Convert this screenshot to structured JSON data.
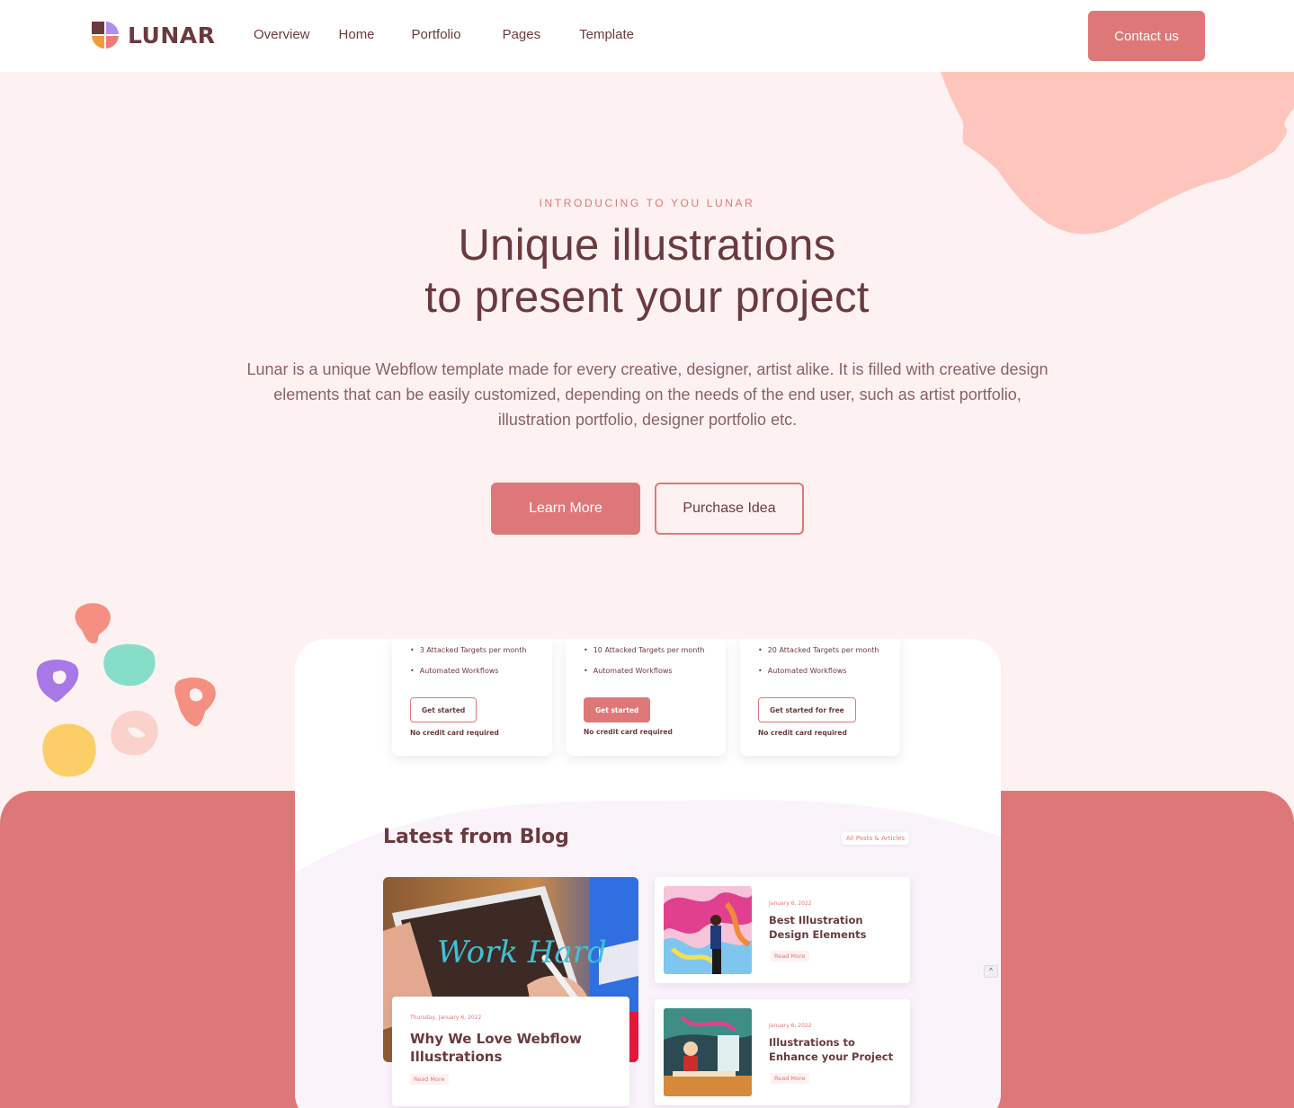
{
  "brand": {
    "name": "LUNAR"
  },
  "nav": {
    "links": [
      "Overview",
      "Home",
      "Portfolio",
      "Pages",
      "Template"
    ],
    "contact_label": "Contact us"
  },
  "hero": {
    "eyebrow": "INTRODUCING TO YOU LUNAR",
    "title_line1": "Unique illustrations",
    "title_line2": "to present your project",
    "lead": "Lunar is a unique Webflow template made for every creative, designer, artist alike. It is filled with creative design elements that can be easily customized, depending on the needs of the end user, such as artist portfolio, illustration portfolio, designer portfolio etc.",
    "learn_more": "Learn More",
    "purchase": "Purchase Idea"
  },
  "pricing_preview": [
    {
      "features": [
        "3 Attacked Targets per month",
        "Automated Workflows"
      ],
      "button": "Get started",
      "note": "No credit card required",
      "highlighted": false
    },
    {
      "features": [
        "10 Attacked Targets per month",
        "Automated Workflows"
      ],
      "button": "Get started",
      "note": "No credit card required",
      "highlighted": true
    },
    {
      "features": [
        "20 Attacked Targets per month",
        "Automated Workflows"
      ],
      "button": "Get started for free",
      "note": "No credit card required",
      "highlighted": false
    }
  ],
  "blog": {
    "title": "Latest from Blog",
    "all_posts": "All Posts & Articles",
    "featured": {
      "date": "Thursday, January 6, 2022",
      "title": "Why We Love Webflow Illustrations",
      "read_more": "Read More",
      "image_text": "Work Hard"
    },
    "posts": [
      {
        "date": "January 6, 2022",
        "title": "Best Illustration Design Elements",
        "read_more": "Read More"
      },
      {
        "date": "January 6, 2022",
        "title": "Illustrations to Enhance your Project",
        "read_more": "Read More"
      }
    ]
  },
  "colors": {
    "primary": "#de7878",
    "text": "#6b3a3e",
    "hero_bg": "#fdf2f1",
    "blob": "#fec5bc"
  },
  "icons": {
    "scroll_top": "chevron-up-icon"
  }
}
